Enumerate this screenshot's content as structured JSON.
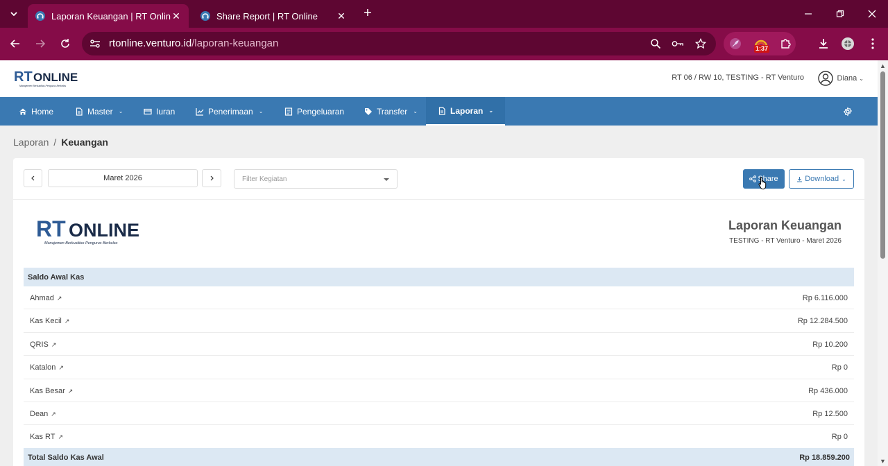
{
  "browser": {
    "tabs": [
      {
        "title": "Laporan Keuangan | RT Online",
        "active": true
      },
      {
        "title": "Share Report | RT Online",
        "active": false
      }
    ],
    "url_host": "rtonline.venturo.id",
    "url_path": "/laporan-keuangan",
    "extension_badge": "1:37"
  },
  "header": {
    "logo_rt": "RT",
    "logo_online": "ONLINE",
    "logo_tagline": "Manajemen Berkualitas Pengurus Berkelas",
    "org": "RT 06 / RW 10, TESTING - RT Venturo",
    "user": "Diana"
  },
  "nav": {
    "items": [
      {
        "label": "Home",
        "icon": "home-icon"
      },
      {
        "label": "Master",
        "icon": "document-icon"
      },
      {
        "label": "Iuran",
        "icon": "card-icon"
      },
      {
        "label": "Penerimaan",
        "icon": "chart-line-icon"
      },
      {
        "label": "Pengeluaran",
        "icon": "receipt-icon"
      },
      {
        "label": "Transfer",
        "icon": "tag-icon"
      },
      {
        "label": "Laporan",
        "icon": "document-icon"
      }
    ]
  },
  "breadcrumb": {
    "parent": "Laporan",
    "current": "Keuangan"
  },
  "toolbar": {
    "period": "Maret 2026",
    "filter_placeholder": "Filter Kegiatan",
    "share_label": "Share",
    "download_label": "Download"
  },
  "report": {
    "title": "Laporan Keuangan",
    "subtitle": "TESTING - RT Venturo - Maret 2026",
    "section": "Saldo Awal Kas",
    "rows": [
      {
        "name": "Ahmad",
        "value": "Rp 6.116.000"
      },
      {
        "name": "Kas Kecil",
        "value": "Rp 12.284.500"
      },
      {
        "name": "QRIS",
        "value": "Rp 10.200"
      },
      {
        "name": "Katalon",
        "value": "Rp 0"
      },
      {
        "name": "Kas Besar",
        "value": "Rp 436.000"
      },
      {
        "name": "Dean",
        "value": "Rp 12.500"
      },
      {
        "name": "Kas RT",
        "value": "Rp 0"
      }
    ],
    "total_label": "Total Saldo Kas Awal",
    "total_value": "Rp 18.859.200"
  },
  "colors": {
    "browser_dark": "#5e0632",
    "browser_mid": "#850c48",
    "brand_blue": "#3a79b2",
    "section_bg": "#dce8f3"
  }
}
